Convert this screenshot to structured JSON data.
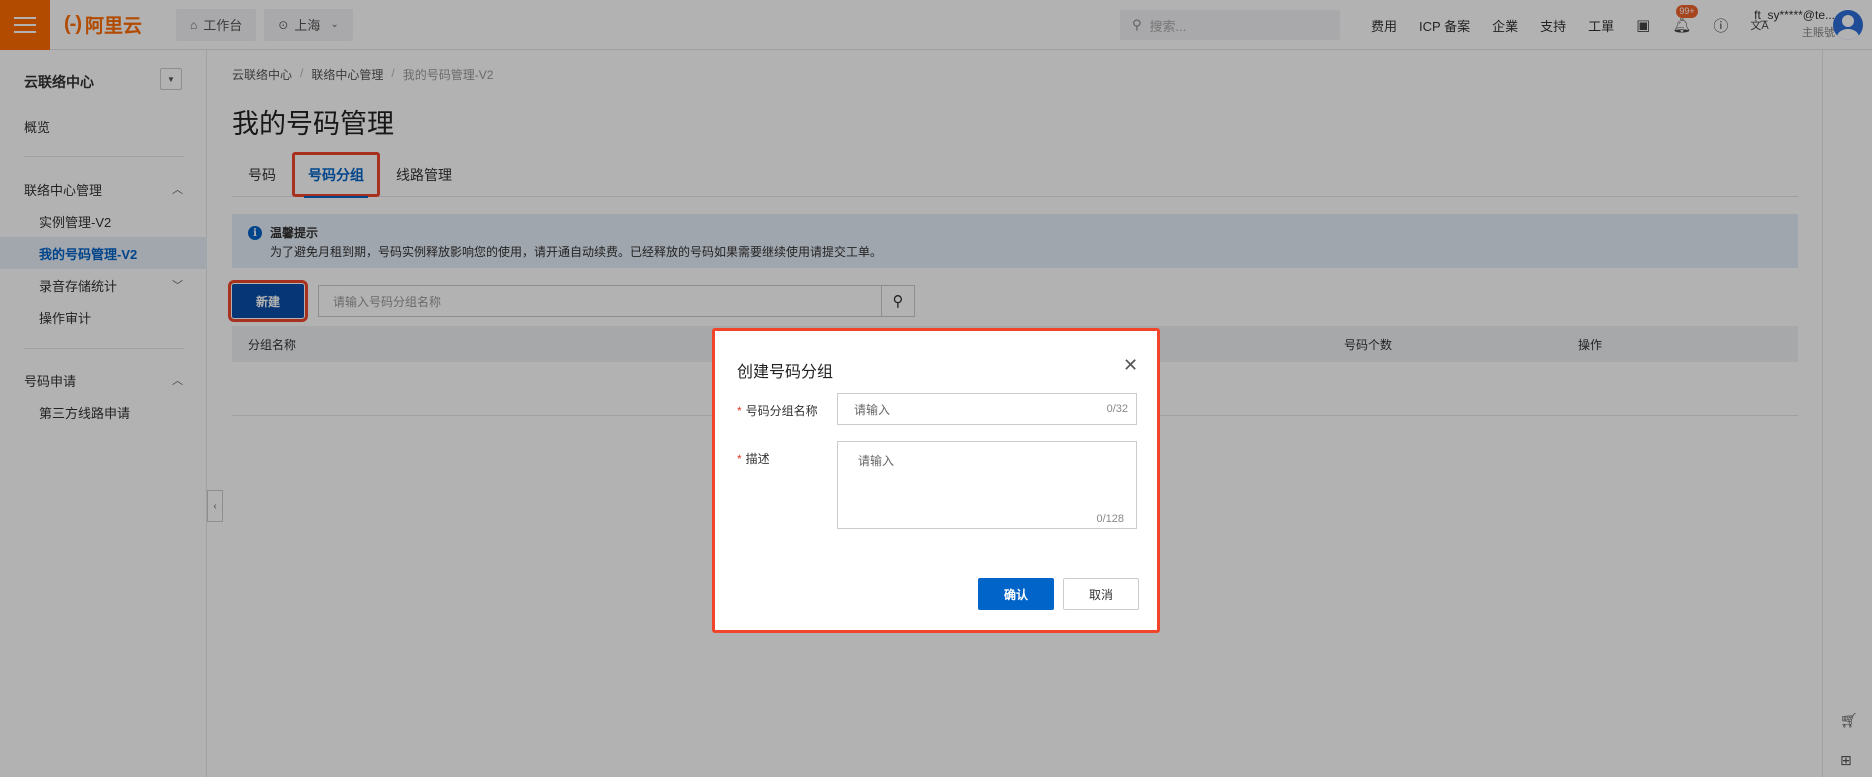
{
  "topbar": {
    "logo": "阿里云",
    "logo_mark": "(-)",
    "workbench": "工作台",
    "region": "上海",
    "search_placeholder": "搜索...",
    "links": [
      "费用",
      "ICP 备案",
      "企業",
      "支持",
      "工單"
    ],
    "badge": "99+",
    "user_name": "ft_sy*****@te...",
    "user_role": "主賬號"
  },
  "sidebar": {
    "title": "云联络中心",
    "overview": "概览",
    "group1": "联络中心管理",
    "group1_items": [
      "实例管理-V2",
      "我的号码管理-V2",
      "录音存储统计",
      "操作审计"
    ],
    "group2": "号码申请",
    "group2_items": [
      "第三方线路申请"
    ]
  },
  "main": {
    "breadcrumb": [
      "云联络中心",
      "联络中心管理",
      "我的号码管理-V2"
    ],
    "title": "我的号码管理",
    "tabs": [
      "号码",
      "号码分组",
      "线路管理"
    ],
    "notice_title": "温馨提示",
    "notice_text": "为了避免月租到期，号码实例释放影响您的使用，请开通自动续费。已经释放的号码如果需要继续使用请提交工单。",
    "new_button": "新建",
    "search_placeholder": "请输入号码分组名称",
    "columns": [
      "分组名称",
      "号码个数",
      "操作"
    ]
  },
  "modal": {
    "title": "创建号码分组",
    "name_label": "号码分组名称",
    "name_placeholder": "请输入",
    "name_count": "0/32",
    "desc_label": "描述",
    "desc_placeholder": "请输入",
    "desc_count": "0/128",
    "confirm": "确认",
    "cancel": "取消"
  }
}
